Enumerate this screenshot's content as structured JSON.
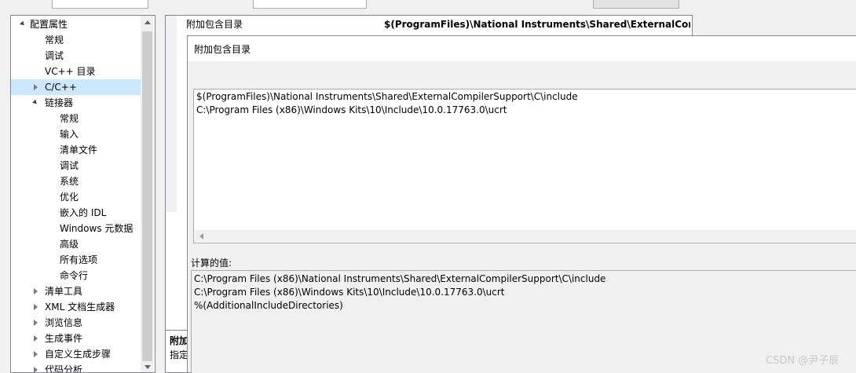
{
  "tree": {
    "root_label": "配置属性",
    "items": [
      {
        "label": "常规"
      },
      {
        "label": "调试"
      },
      {
        "label": "VC++ 目录"
      },
      {
        "label": "C/C++"
      },
      {
        "label": "链接器"
      },
      {
        "label": "常规"
      },
      {
        "label": "输入"
      },
      {
        "label": "清单文件"
      },
      {
        "label": "调试"
      },
      {
        "label": "系统"
      },
      {
        "label": "优化"
      },
      {
        "label": "嵌入的 IDL"
      },
      {
        "label": "Windows 元数据"
      },
      {
        "label": "高级"
      },
      {
        "label": "所有选项"
      },
      {
        "label": "命令行"
      },
      {
        "label": "清单工具"
      },
      {
        "label": "XML 文档生成器"
      },
      {
        "label": "浏览信息"
      },
      {
        "label": "生成事件"
      },
      {
        "label": "自定义生成步骤"
      },
      {
        "label": "代码分析"
      }
    ]
  },
  "grid": {
    "property_name": "附加包含目录",
    "property_value": "$(ProgramFiles)\\National Instruments\\Shared\\ExternalCompi",
    "desc_title": "附加",
    "desc_text": "指定"
  },
  "dialog": {
    "title": "附加包含目录",
    "lines": [
      "$(ProgramFiles)\\National Instruments\\Shared\\ExternalCompilerSupport\\C\\include",
      "C:\\Program Files (x86)\\Windows Kits\\10\\Include\\10.0.17763.0\\ucrt"
    ],
    "evaluated_label": "计算的值:",
    "evaluated_lines": [
      "C:\\Program Files (x86)\\National Instruments\\Shared\\ExternalCompilerSupport\\C\\include",
      "C:\\Program Files (x86)\\Windows Kits\\10\\Include\\10.0.17763.0\\ucrt",
      "%(AdditionalIncludeDirectories)"
    ]
  },
  "watermark": "CSDN @尹子辰"
}
